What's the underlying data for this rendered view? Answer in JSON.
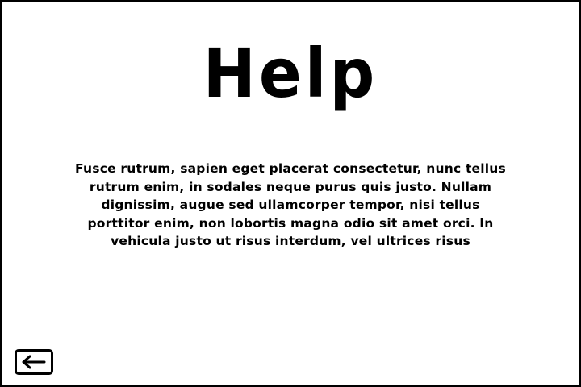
{
  "screen": {
    "title": "Help",
    "body": "Fusce rutrum, sapien eget placerat consectetur, nunc tellus rutrum enim, in sodales neque purus quis justo. Nullam dignissim, augue sed ullamcorper tempor, nisi tellus porttitor enim, non lobortis magna odio sit amet orci. In vehicula justo ut risus interdum, vel ultrices risus"
  },
  "back_button": {
    "icon": "arrow-left-icon"
  },
  "colors": {
    "background": "#ffffff",
    "foreground": "#000000"
  }
}
